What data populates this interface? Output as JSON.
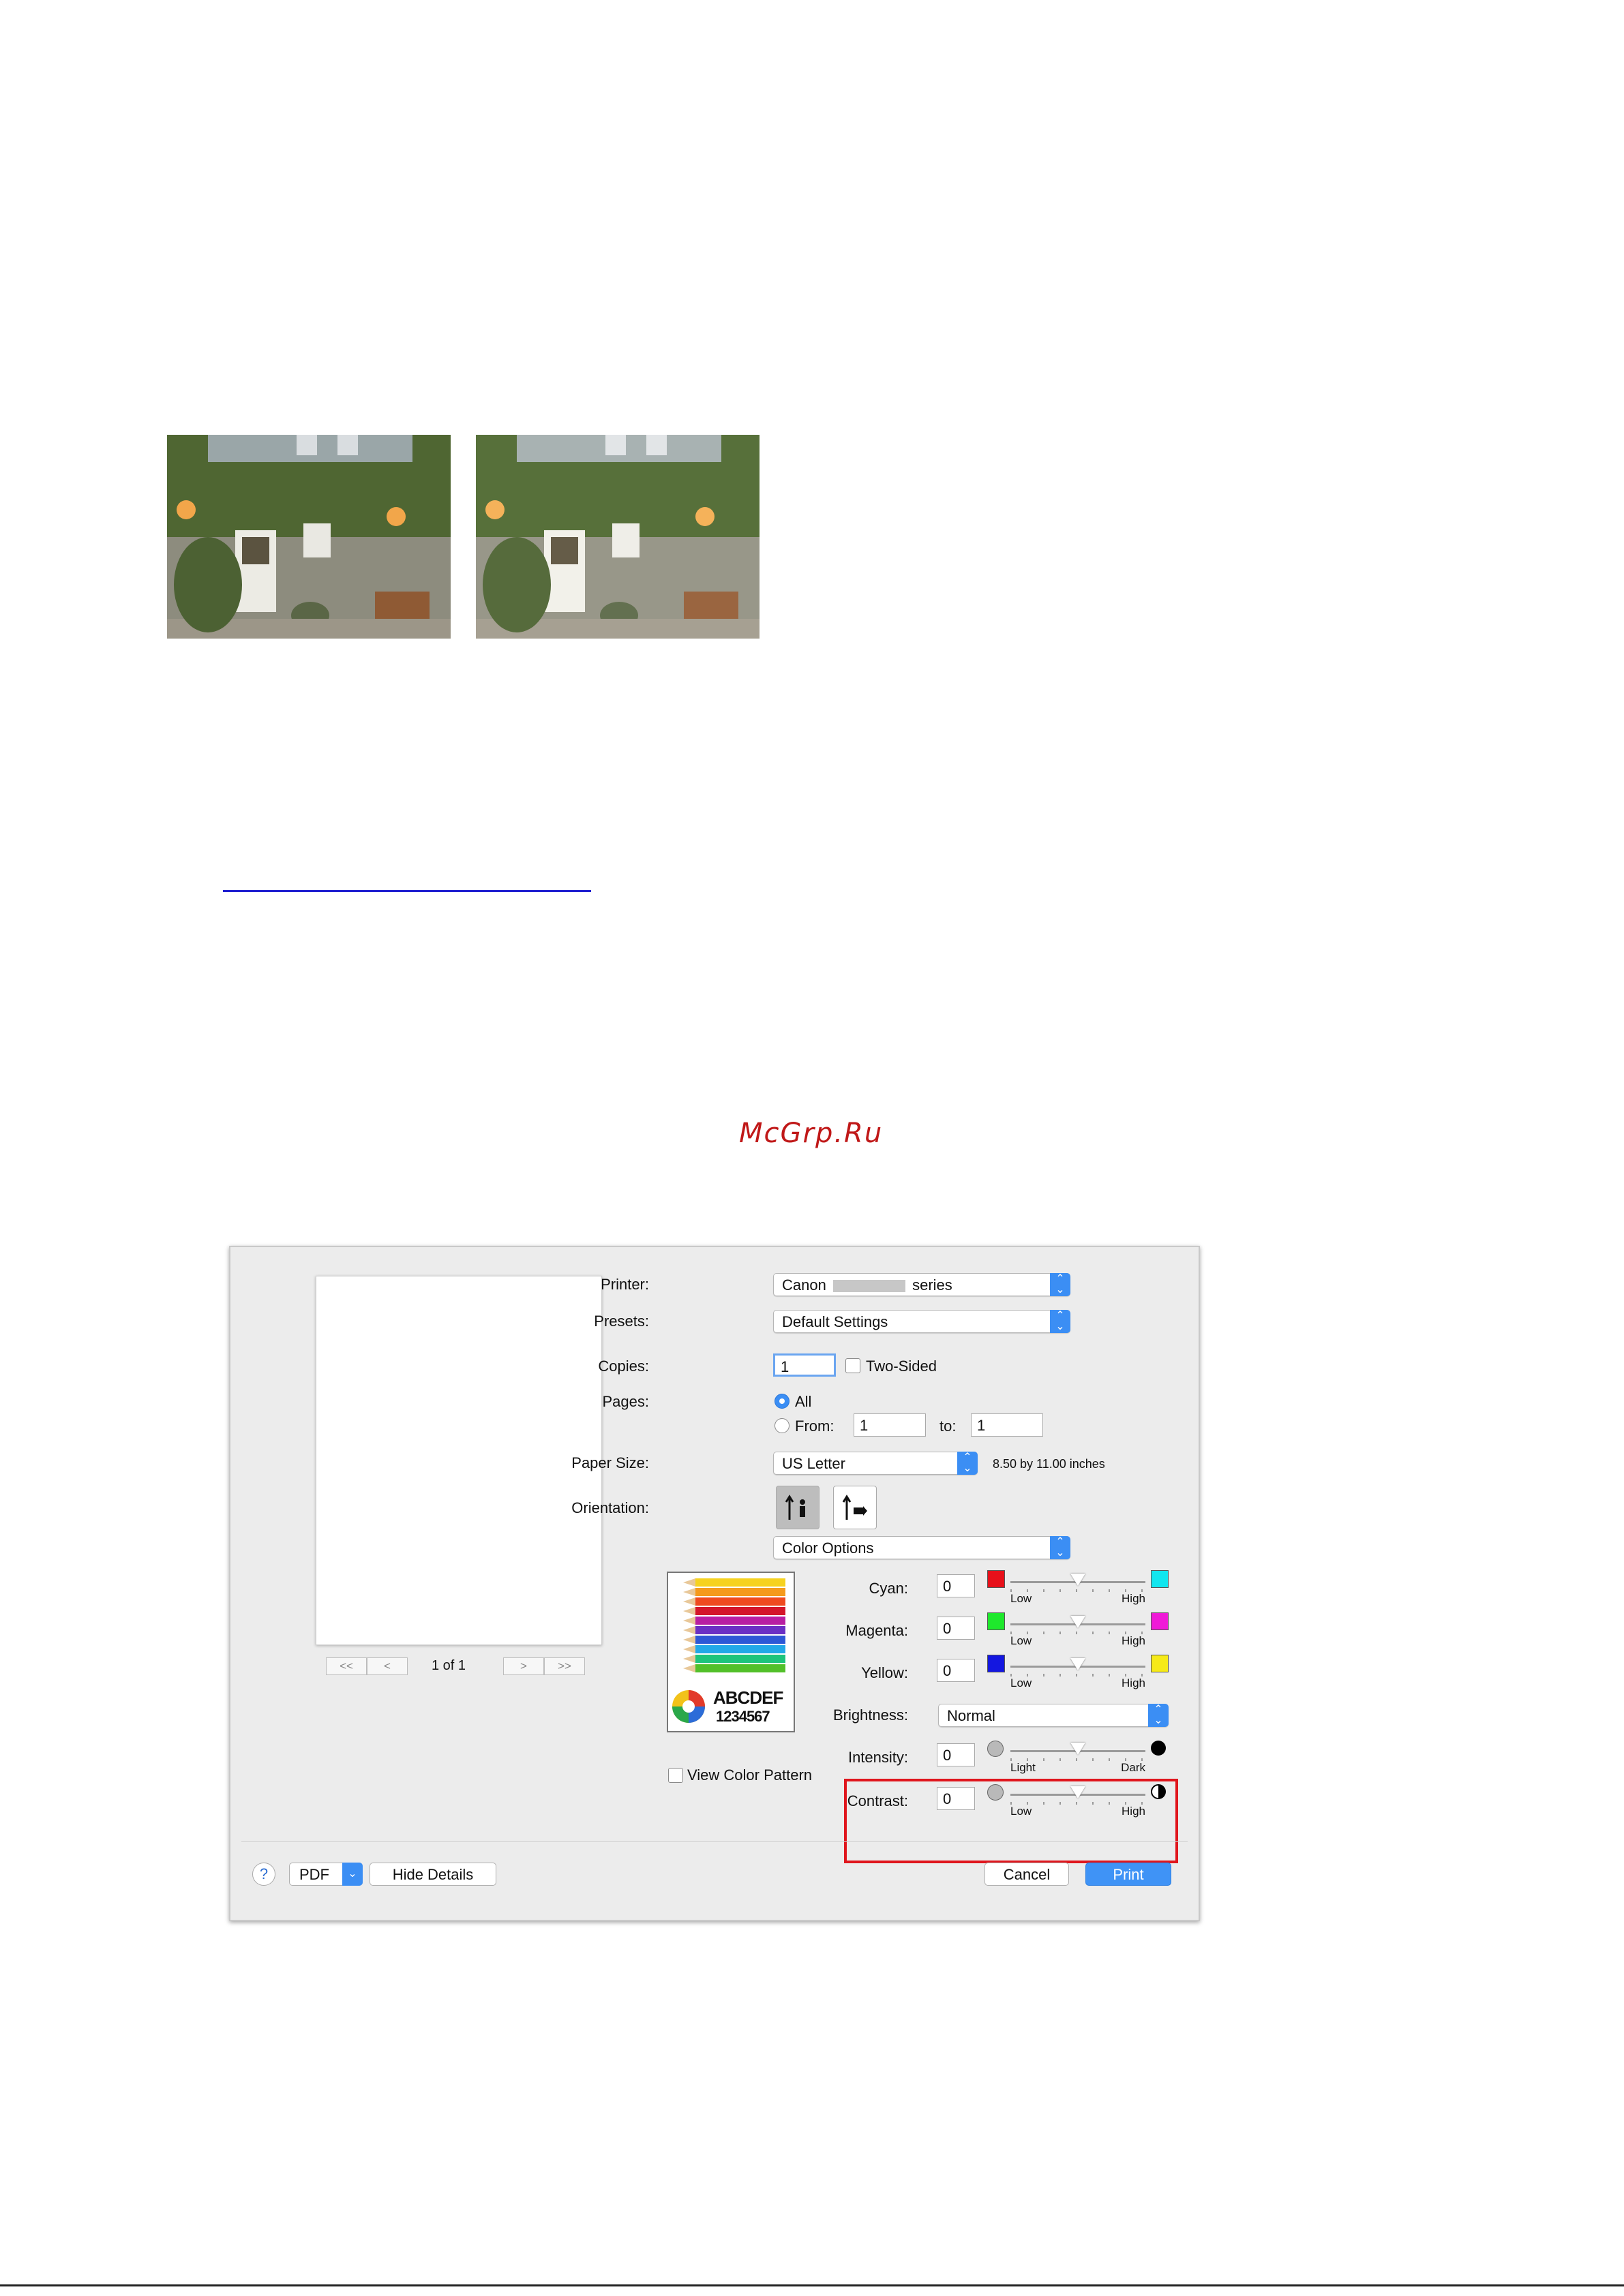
{
  "images": {
    "left_photo": "photo-before-contrast",
    "right_photo": "photo-after-contrast"
  },
  "watermark": "McGrp.Ru",
  "dialog": {
    "preview": {
      "page_count": "1 of 1",
      "nav_first": "<<",
      "nav_prev": "<",
      "nav_next": ">",
      "nav_last": ">>"
    },
    "printer": {
      "label": "Printer:",
      "value_prefix": "Canon",
      "value_suffix": "series"
    },
    "presets": {
      "label": "Presets:",
      "value": "Default Settings"
    },
    "copies": {
      "label": "Copies:",
      "value": "1",
      "two_sided": "Two-Sided"
    },
    "pages": {
      "label": "Pages:",
      "all": "All",
      "from": "From:",
      "from_value": "1",
      "to": "to:",
      "to_value": "1"
    },
    "paper_size": {
      "label": "Paper Size:",
      "value": "US Letter",
      "dimensions": "8.50 by 11.00 inches"
    },
    "orientation": {
      "label": "Orientation:"
    },
    "section": {
      "value": "Color Options"
    },
    "pattern": {
      "abc": "ABCDEF",
      "num": "1234567",
      "view_color_pattern": "View Color Pattern"
    },
    "cyan": {
      "label": "Cyan:",
      "value": "0",
      "low": "Low",
      "high": "High",
      "color_low": "#e8101a",
      "color_high": "#11e6ef"
    },
    "magenta": {
      "label": "Magenta:",
      "value": "0",
      "low": "Low",
      "high": "High",
      "color_low": "#1ee82c",
      "color_high": "#ef1ad7"
    },
    "yellow": {
      "label": "Yellow:",
      "value": "0",
      "low": "Low",
      "high": "High",
      "color_low": "#1417e0",
      "color_high": "#f6ea18"
    },
    "brightness": {
      "label": "Brightness:",
      "value": "Normal"
    },
    "intensity": {
      "label": "Intensity:",
      "value": "0",
      "low": "Light",
      "high": "Dark"
    },
    "contrast": {
      "label": "Contrast:",
      "value": "0",
      "low": "Low",
      "high": "High"
    },
    "footer": {
      "help": "?",
      "pdf": "PDF",
      "hide_details": "Hide Details",
      "cancel": "Cancel",
      "print": "Print"
    }
  }
}
